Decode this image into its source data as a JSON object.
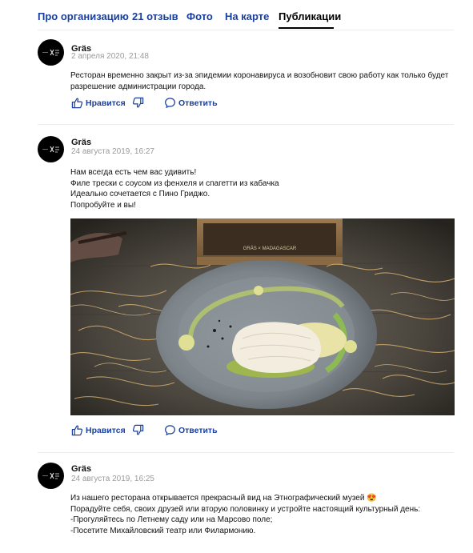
{
  "tabs": [
    {
      "label": "Про организацию"
    },
    {
      "label": "21 отзыв"
    },
    {
      "label": "Фото"
    },
    {
      "label": "На карте"
    },
    {
      "label": "Публикации"
    }
  ],
  "active_tab": "Публикации",
  "posts": [
    {
      "author": "Gräs",
      "date": "2 апреля 2020, 21:48",
      "lines": [
        "Ресторан временно закрыт из-за эпидемии коронавируса и возобновит свою работу как только будет",
        "разрешение администрации города."
      ],
      "actions": {
        "like": "Нравится",
        "reply": "Ответить"
      }
    },
    {
      "author": "Gräs",
      "date": "24 августа 2019, 16:27",
      "lines": [
        "Нам всегда есть чем вас удивить!",
        "Филе трески с соусом из фенхеля и спагетти из кабачка",
        "Идеально сочетается с Пино Гриджо.",
        "Попробуйте и вы!"
      ],
      "photo": {
        "box_text": "GRÄS × MADAGASCAR"
      },
      "actions": {
        "like": "Нравится",
        "reply": "Ответить"
      }
    },
    {
      "author": "Gräs",
      "date": "24 августа 2019, 16:25",
      "lines": [
        "Из нашего ресторана открывается прекрасный вид на Этнографический музей 😍",
        "Порадуйте себя, своих друзей или вторую половинку и устройте настоящий культурный день:",
        "-Прогуляйтесь по Летнему саду или на Марсово поле;",
        "-Посетите Михайловский театр или Филармонию."
      ]
    }
  ],
  "colors": {
    "link": "#1a3f9c",
    "muted": "#9a9a9a",
    "text": "#111111"
  }
}
